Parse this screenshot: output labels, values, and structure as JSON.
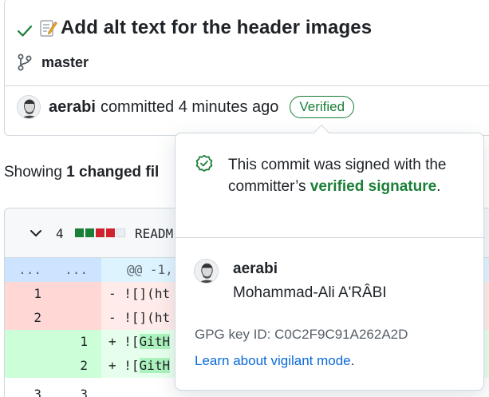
{
  "commit": {
    "title": "Add alt text for the header images",
    "branch": "master",
    "author": "aerabi",
    "action_text": "committed 4 minutes ago",
    "badge": "Verified"
  },
  "summary": {
    "prefix": "Showing ",
    "changed": "1 changed fil"
  },
  "file": {
    "change_count": "4",
    "name": "READM",
    "diffstat_colors": [
      "#1a7f37",
      "#1a7f37",
      "#cf222e",
      "#cf222e",
      "#eaeef2"
    ]
  },
  "diff": {
    "hunk": {
      "old": "...",
      "new": "...",
      "text": "@@ -1,"
    },
    "rows": [
      {
        "type": "del",
        "old": "1",
        "new": "",
        "marker": "-",
        "code": "![](ht"
      },
      {
        "type": "del",
        "old": "2",
        "new": "",
        "marker": "-",
        "code": "![](ht"
      },
      {
        "type": "add",
        "old": "",
        "new": "1",
        "marker": "+",
        "pre": "![",
        "hl": "GitH"
      },
      {
        "type": "add",
        "old": "",
        "new": "2",
        "marker": "+",
        "pre": "![",
        "hl": "GitH"
      },
      {
        "type": "ctx",
        "old": "3",
        "new": "3",
        "marker": "",
        "code": ""
      }
    ]
  },
  "popover": {
    "message_pre": "This commit was signed with the committer’s ",
    "message_bold": "verified signature",
    "message_post": ".",
    "login": "aerabi",
    "full_name": "Mohammad-Ali A'RÂBI",
    "gpg_label": "GPG key ID: ",
    "gpg_key": "C0C2F9C91A262A2D",
    "learn_link": "Learn about vigilant mode",
    "learn_post": "."
  },
  "colors": {
    "verified_green": "#1a7f37",
    "link_blue": "#0969da",
    "border": "#d0d7de"
  }
}
